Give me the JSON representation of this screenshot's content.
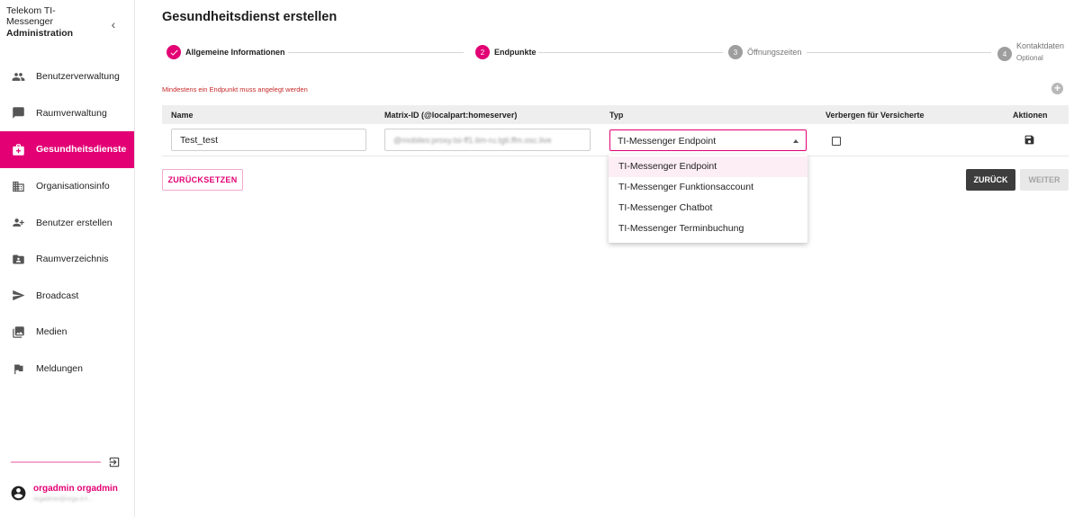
{
  "sidebar": {
    "brand_line1": "Telekom TI-",
    "brand_line2": "Messenger",
    "brand_admin": "Administration",
    "items": [
      {
        "label": "Benutzerverwaltung",
        "icon": "people-icon"
      },
      {
        "label": "Raumverwaltung",
        "icon": "chat-icon"
      },
      {
        "label": "Gesundheitsdienste",
        "icon": "medical-bag-icon",
        "active": true
      },
      {
        "label": "Organisationsinfo",
        "icon": "business-icon"
      },
      {
        "label": "Benutzer erstellen",
        "icon": "add-user-icon"
      },
      {
        "label": "Raumverzeichnis",
        "icon": "contact-folder-icon"
      },
      {
        "label": "Broadcast",
        "icon": "send-icon"
      },
      {
        "label": "Medien",
        "icon": "photo-library-icon"
      },
      {
        "label": "Meldungen",
        "icon": "flag-icon"
      }
    ],
    "user": {
      "name": "orgadmin orgadmin",
      "sub": "orgadmin@orga.ti-f..."
    }
  },
  "page": {
    "title": "Gesundheitsdienst erstellen"
  },
  "stepper": {
    "steps": [
      {
        "label": "Allgemeine Informationen",
        "state": "done"
      },
      {
        "label": "Endpunkte",
        "number": "2",
        "state": "active"
      },
      {
        "label": "Öffnungszeiten",
        "number": "3",
        "state": "pending"
      },
      {
        "label": "Kontaktdaten",
        "number": "4",
        "state": "pending",
        "sub": "Optional"
      }
    ]
  },
  "form": {
    "hint": "Mindestens ein Endpunkt muss angelegt werden",
    "columns": {
      "name": "Name",
      "matrix_id": "Matrix-ID (@localpart:homeserver)",
      "type": "Typ",
      "hide": "Verbergen für Versicherte",
      "actions": "Aktionen"
    },
    "row": {
      "name": "Test_test",
      "matrix_id": "@mobiles:proxy.tsi-ff1.tim-ru.tgti.ffm.osc.live",
      "type": "TI-Messenger Endpoint",
      "hidden": false
    },
    "type_options": [
      "TI-Messenger Endpoint",
      "TI-Messenger Funktionsaccount",
      "TI-Messenger Chatbot",
      "TI-Messenger Terminbuchung"
    ],
    "selected_option": "TI-Messenger Endpoint"
  },
  "buttons": {
    "reset": "ZURÜCKSETZEN",
    "back": "ZURÜCK",
    "next": "WEITER"
  },
  "colors": {
    "accent": "#e20074",
    "dark_button": "#3d3d3d"
  }
}
